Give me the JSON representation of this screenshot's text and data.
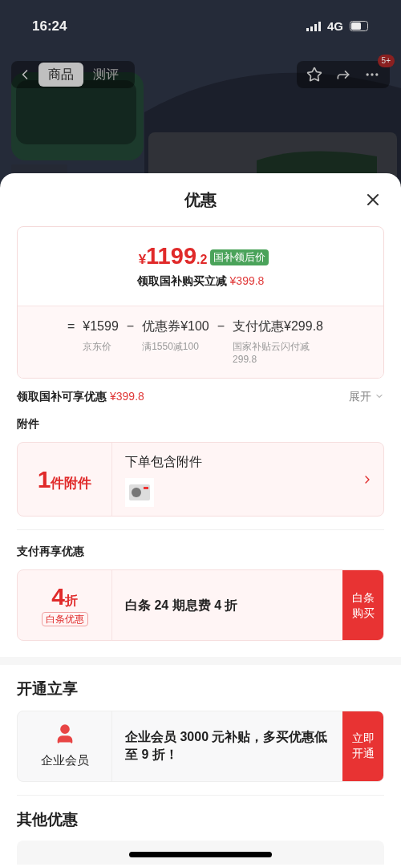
{
  "status_bar": {
    "time": "16:24",
    "network": "4G"
  },
  "nav": {
    "tabs": [
      {
        "label": "商品",
        "selected": true
      },
      {
        "label": "测评",
        "selected": false
      }
    ],
    "badge": "5+"
  },
  "sheet": {
    "title": "优惠",
    "price_card": {
      "currency": "¥",
      "price": "1199",
      "price_decimal": ".2",
      "tag": "国补领后价",
      "subtitle": "领取国补购买立减",
      "subtitle_amount": "¥399.8",
      "breakdown": [
        {
          "op": "=",
          "value": "¥1599",
          "note": "京东价"
        },
        {
          "op": "−",
          "value": "优惠券¥100",
          "note": "满1550减100"
        },
        {
          "op": "−",
          "value": "支付优惠¥299.8",
          "note": "国家补贴云闪付减299.8"
        }
      ]
    },
    "subsidy_row": {
      "label": "领取国补可享优惠",
      "amount": "¥399.8",
      "toggle": "展开",
      "expanded": false
    },
    "sections": [
      {
        "kind": "accessory",
        "title": "附件",
        "count": "1",
        "count_unit": "件附件",
        "text": "下单包含附件"
      },
      {
        "kind": "discount",
        "title": "支付再享优惠",
        "big": "4",
        "big_unit": "折",
        "tag": "白条优惠",
        "text": "白条 24 期息费 4 折",
        "action": "白条购买"
      },
      {
        "kind": "member",
        "title": "开通立享",
        "label": "企业会员",
        "text": "企业会员 3000 元补贴，多买优惠低至 9 折！",
        "action": "立即开通"
      },
      {
        "kind": "other",
        "title": "其他优惠"
      }
    ]
  }
}
